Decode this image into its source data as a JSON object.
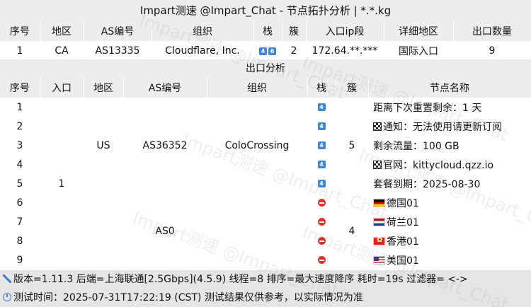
{
  "title": "Impart测速 @Impart_Chat - 节点拓扑分析 | *.*.kg",
  "inbound": {
    "headers": [
      "序号",
      "地区",
      "AS编号",
      "组织",
      "栈",
      "簇",
      "入口ip段",
      "详细地区",
      "出口数量"
    ],
    "row": {
      "index": "1",
      "region": "CA",
      "asn": "AS13335",
      "org": "Cloudflare, Inc.",
      "stack": [
        "4",
        "6"
      ],
      "cluster": "2",
      "ip_range": "172.64.**.***",
      "detail_region": "国际入口",
      "exit_count": "9"
    }
  },
  "outbound": {
    "title": "出口分析",
    "headers": [
      "序号",
      "入口",
      "地区",
      "AS编号",
      "组织",
      "栈",
      "簇",
      "节点名称"
    ],
    "entry": "1",
    "groups": [
      {
        "region": "US",
        "asn": "AS36352",
        "org": "ColoCrossing",
        "cluster": "5"
      },
      {
        "region": "",
        "asn": "AS0",
        "org": "",
        "cluster": "4"
      }
    ],
    "rows": [
      {
        "index": "1",
        "stack": "4",
        "flag": "",
        "name": "距离下次重置剩余：1 天"
      },
      {
        "index": "2",
        "stack": "4",
        "flag": "checkered",
        "name": "通知：无法使用请更新订阅"
      },
      {
        "index": "3",
        "stack": "4",
        "flag": "",
        "name": "剩余流量：100 GB"
      },
      {
        "index": "4",
        "stack": "4",
        "flag": "checkered",
        "name": "官网：kittycloud.qzz.io"
      },
      {
        "index": "5",
        "stack": "4",
        "flag": "",
        "name": "套餐到期：2025-08-30"
      },
      {
        "index": "6",
        "stack": "blocked",
        "flag": "de",
        "name": "德国01"
      },
      {
        "index": "7",
        "stack": "blocked",
        "flag": "nl",
        "name": "荷兰01"
      },
      {
        "index": "8",
        "stack": "blocked",
        "flag": "hk",
        "name": "香港01"
      },
      {
        "index": "9",
        "stack": "blocked",
        "flag": "us",
        "name": "美国01"
      }
    ]
  },
  "footer": {
    "line1": "版本=1.11.3  后端=上海联通[2.5Gbps](4.5.9)  线程=8  排序=最大速度降序  耗时=19s   过滤器= <->",
    "line2": "测试时间：2025-07-31T17:22:19 (CST)  测试结果仅供参考，以实际情况为准"
  },
  "watermark": "Impart测速 @Impart_Chat",
  "colors": {
    "header_bg": "#ededed",
    "stack_badge": "#3f86d4",
    "blocked": "#d9342b"
  }
}
